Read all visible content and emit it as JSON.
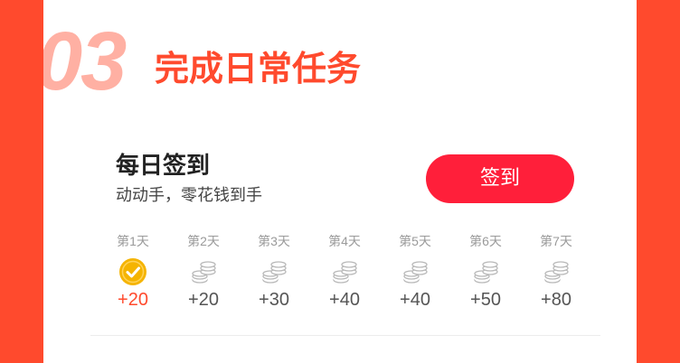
{
  "section": {
    "number": "03",
    "title": "完成日常任务"
  },
  "task": {
    "title": "每日签到",
    "subtitle": "动动手，零花钱到手",
    "button_label": "签到"
  },
  "days": [
    {
      "label": "第1天",
      "points": "+20",
      "state": "checked",
      "icon": "check-icon"
    },
    {
      "label": "第2天",
      "points": "+20",
      "state": "pending",
      "icon": "coin-stack-icon"
    },
    {
      "label": "第3天",
      "points": "+30",
      "state": "pending",
      "icon": "coin-stack-icon"
    },
    {
      "label": "第4天",
      "points": "+40",
      "state": "pending",
      "icon": "coin-stack-icon"
    },
    {
      "label": "第5天",
      "points": "+40",
      "state": "pending",
      "icon": "coin-stack-icon"
    },
    {
      "label": "第6天",
      "points": "+50",
      "state": "pending",
      "icon": "coin-stack-icon"
    },
    {
      "label": "第7天",
      "points": "+80",
      "state": "pending",
      "icon": "coin-stack-icon"
    }
  ],
  "colors": {
    "page_background": "#ff4a2d",
    "accent": "#ff4a2d",
    "button": "#ff1f3a",
    "check_badge": "#f5b400",
    "step_number": "#ffb0a3"
  }
}
